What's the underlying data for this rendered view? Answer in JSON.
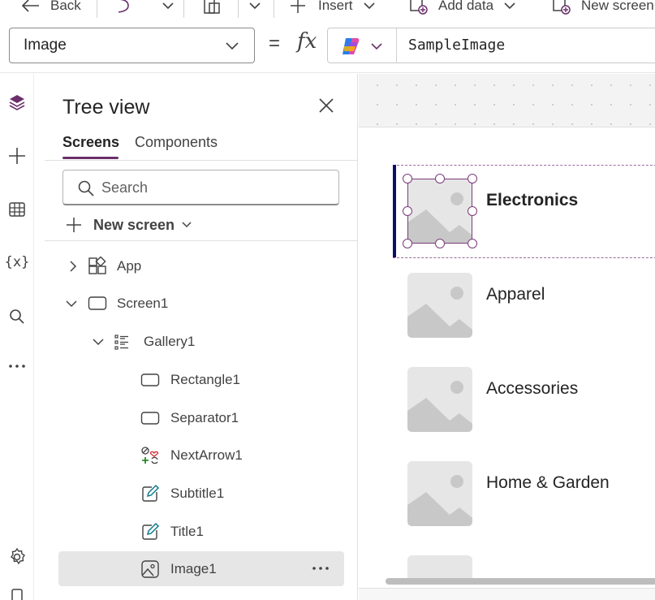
{
  "commandbar": {
    "back_label": "Back",
    "insert_label": "Insert",
    "add_data_label": "Add data",
    "new_screen_label": "New screen"
  },
  "formula_bar": {
    "property": "Image",
    "equals": "=",
    "fx": "fx",
    "formula": "SampleImage"
  },
  "tree_view": {
    "title": "Tree view",
    "tabs": [
      "Screens",
      "Components"
    ],
    "active_tab": "Screens",
    "search_placeholder": "Search",
    "new_screen_label": "New screen",
    "nodes": {
      "app": "App",
      "screen1": "Screen1",
      "gallery1": "Gallery1",
      "rectangle1": "Rectangle1",
      "separator1": "Separator1",
      "nextarrow1": "NextArrow1",
      "subtitle1": "Subtitle1",
      "title1": "Title1",
      "image1": "Image1"
    },
    "selected_node": "Image1"
  },
  "canvas": {
    "gallery_items": [
      "Electronics",
      "Apparel",
      "Accessories",
      "Home & Garden"
    ],
    "selected_item": "Electronics"
  },
  "colors": {
    "accent": "#6b2f6b",
    "selection_bar": "#0d0d6b",
    "placeholder_image": "#d9d9d9"
  }
}
